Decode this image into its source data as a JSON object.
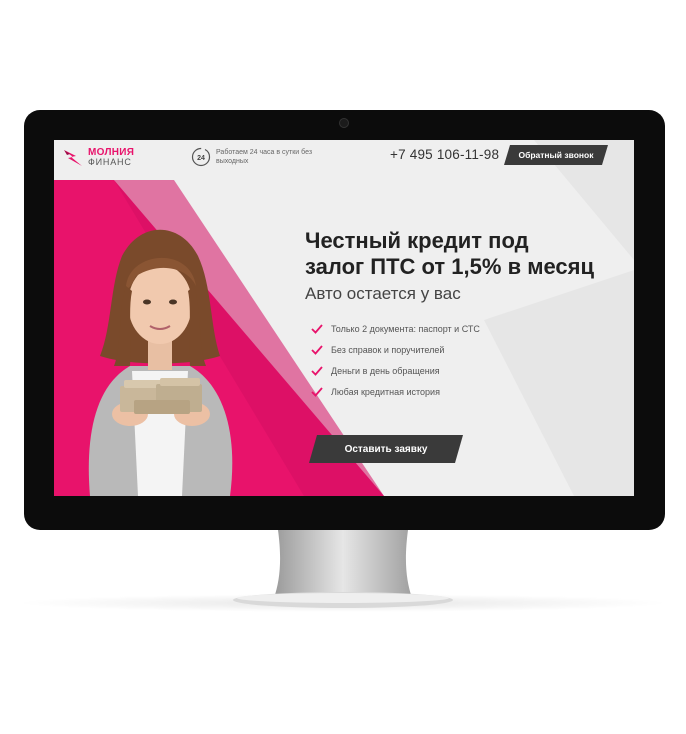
{
  "brand": {
    "name_line1": "МОЛНИЯ",
    "name_line2": "ФИНАНС",
    "color": "#e8136b"
  },
  "header": {
    "hours_badge": "24",
    "hours_text": "Работаем 24 часа в сутки без выходных",
    "phone": "+7 495 106-11-98",
    "callback_label": "Обратный звонок"
  },
  "hero": {
    "title_line1": "Честный кредит под",
    "title_line2": "залог ПТС от 1,5% в месяц",
    "subtitle": "Авто остается у вас",
    "features": [
      "Только 2 документа: паспорт и СТС",
      "Без справок и поручителей",
      "Деньги в день обращения",
      "Любая кредитная история"
    ],
    "cta_label": "Оставить заявку"
  },
  "colors": {
    "accent": "#e8136b",
    "dark_button": "#3a3a3a",
    "screen_bg": "#efefef",
    "bezel": "#0c0c0c"
  },
  "icons": {
    "logo": "lightning-logo-icon",
    "hours": "clock-24-icon",
    "check": "check-icon"
  }
}
